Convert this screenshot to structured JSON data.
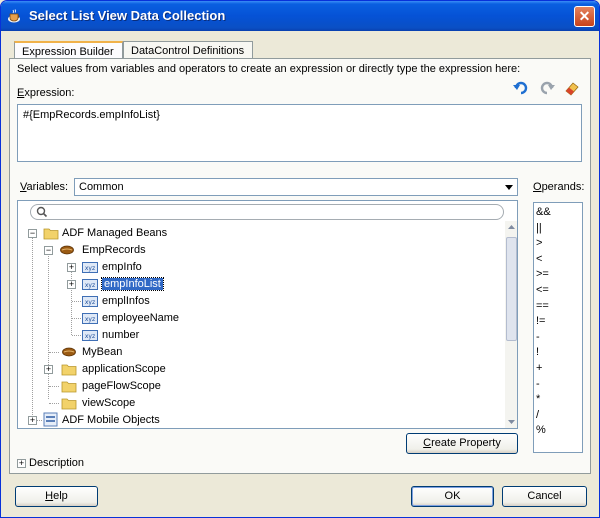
{
  "window": {
    "title": "Select List View Data Collection",
    "close_glyph": "✕"
  },
  "tabs": [
    {
      "label": "Expression Builder",
      "active": true
    },
    {
      "label": "DataControl Definitions",
      "active": false
    }
  ],
  "instructions": "Select values from variables and operators to create an expression or directly type the expression here:",
  "expression": {
    "label_first": "E",
    "label_rest": "xpression:",
    "value": "#{EmpRecords.empInfoList}"
  },
  "variables": {
    "label_first": "V",
    "label_rest": "ariables:",
    "selected": "Common"
  },
  "operands": {
    "label_first": "O",
    "label_rest": "perands:",
    "items": [
      "&&",
      "||",
      ">",
      "<",
      ">=",
      "<=",
      "==",
      "!=",
      "-",
      "!",
      "+",
      "-",
      "*",
      "/",
      "%"
    ]
  },
  "tree": {
    "adf_managed_beans": "ADF Managed Beans",
    "emp_records": "EmpRecords",
    "emp_info": "empInfo",
    "emp_info_list": "empInfoList",
    "empl_infos": "emplInfos",
    "employee_name": "employeeName",
    "number": "number",
    "my_bean": "MyBean",
    "application_scope": "applicationScope",
    "page_flow_scope": "pageFlowScope",
    "view_scope": "viewScope",
    "adf_mobile_objects": "ADF Mobile Objects",
    "expand_glyph": "+",
    "collapse_glyph": "−"
  },
  "buttons": {
    "create_property_first": "C",
    "create_property_rest": "reate Property",
    "help_first": "H",
    "help_rest": "elp",
    "ok": "OK",
    "cancel": "Cancel"
  },
  "description": {
    "label": "Description",
    "glyph": "+"
  },
  "icons": [
    "coffee-cup-icon",
    "close-icon",
    "undo-icon",
    "redo-icon",
    "eraser-icon",
    "search-icon",
    "folder-icon",
    "bean-icon",
    "property-icon",
    "data-objects-icon",
    "dropdown-arrow-icon"
  ],
  "colors": {
    "title_bar": "#0552d6",
    "selection": "#3169c6",
    "dialog_bg": "#ece9d8",
    "folder": "#f2d26a"
  }
}
